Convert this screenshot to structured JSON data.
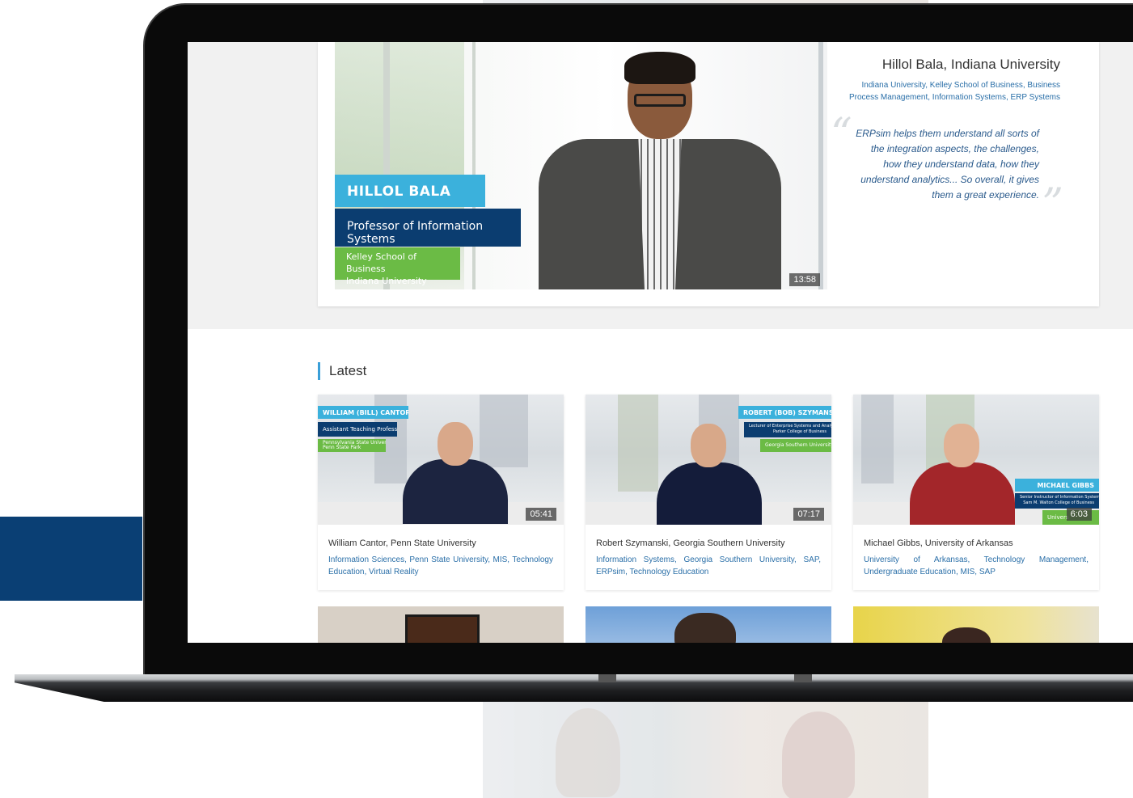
{
  "featured": {
    "lower_third": {
      "name": "HILLOL BALA",
      "title": "Professor of Information Systems",
      "school_line1": "Kelley School of Business",
      "school_line2": "Indiana University"
    },
    "duration": "13:58",
    "heading": "Hillol Bala, Indiana University",
    "tags_line1": "Indiana University, Kelley School of Business, Business",
    "tags_line2": "Process Management, Information Systems, ERP Systems",
    "quote_lines": [
      "ERPsim helps them understand all sorts of",
      "the integration aspects, the challenges,",
      "how they understand data, how they",
      "understand analytics... So overall, it gives",
      "them a great experience."
    ]
  },
  "latest": {
    "heading": "Latest",
    "cards": [
      {
        "lt_name": "WILLIAM (BILL) CANTOR",
        "lt_title": "Assistant Teaching Professor",
        "lt_school1": "Pennsylvania State University -",
        "lt_school2": "Penn State Park",
        "duration": "05:41",
        "title": "William Cantor, Penn State University",
        "tags": "Information Sciences, Penn State University, MIS, Technology Education, Virtual Reality"
      },
      {
        "lt_name": "ROBERT (BOB) SZYMANSKI",
        "lt_title1": "Lecturer of Enterprise Systems and Analytics",
        "lt_title2": "Parker College of Business",
        "lt_school1": "Georgia Southern University",
        "duration": "07:17",
        "title": "Robert Szymanski, Georgia Southern University",
        "tags": "Information Systems, Georgia Southern University, SAP, ERPsim, Technology Education"
      },
      {
        "lt_name": "MICHAEL GIBBS",
        "lt_title1": "Senior Instructor of Information Systems",
        "lt_title2": "Sam M. Walton College of Business",
        "lt_school1": "Univers",
        "duration": "6:03",
        "title": "Michael Gibbs, University of Arkansas",
        "tags": "University of Arkansas, Technology Management, Undergraduate Education, MIS, SAP"
      }
    ]
  },
  "colors": {
    "accent_blue": "#3bb1dc",
    "navy": "#0b3d70",
    "green": "#6bbb45",
    "link": "#2a6fa8"
  }
}
